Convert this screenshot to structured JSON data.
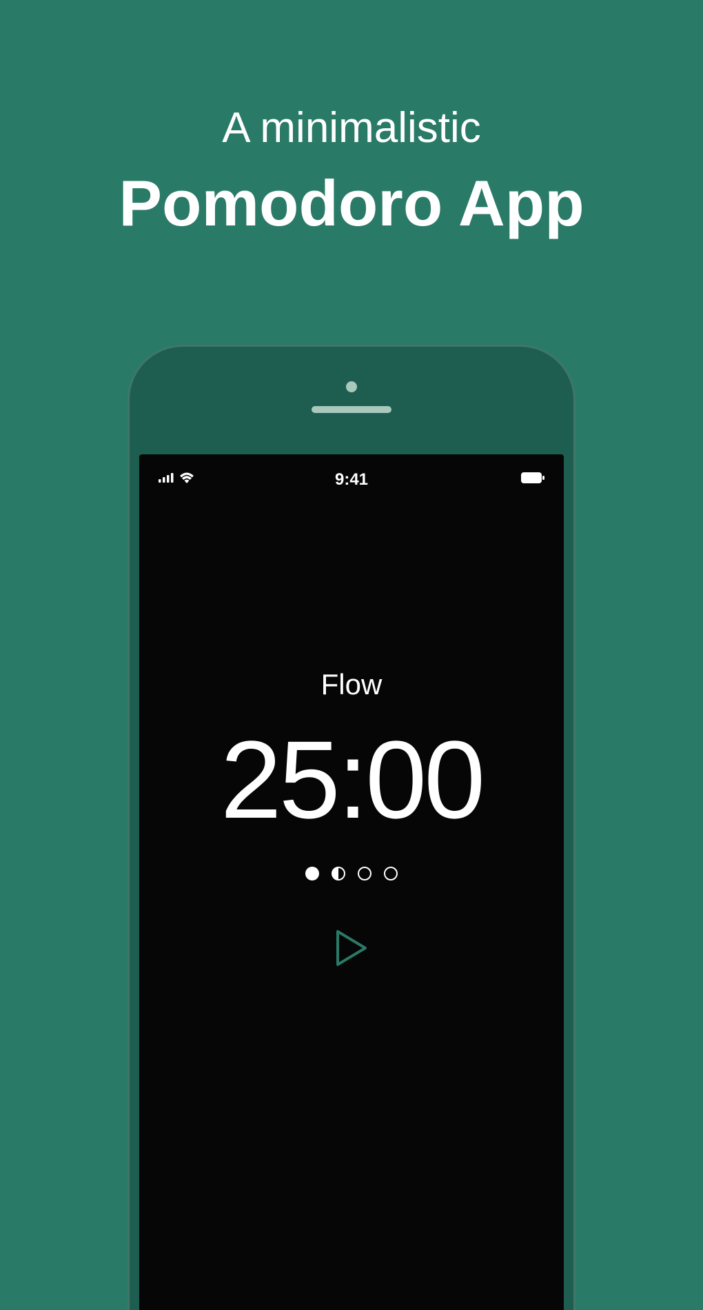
{
  "header": {
    "subtitle": "A minimalistic",
    "title": "Pomodoro App"
  },
  "statusBar": {
    "time": "9:41"
  },
  "timer": {
    "sessionLabel": "Flow",
    "timeDisplay": "25:00"
  },
  "colors": {
    "background": "#2a7a68",
    "phoneFrame": "#1e5e50",
    "screen": "#050605",
    "accent": "#2a7a68"
  }
}
